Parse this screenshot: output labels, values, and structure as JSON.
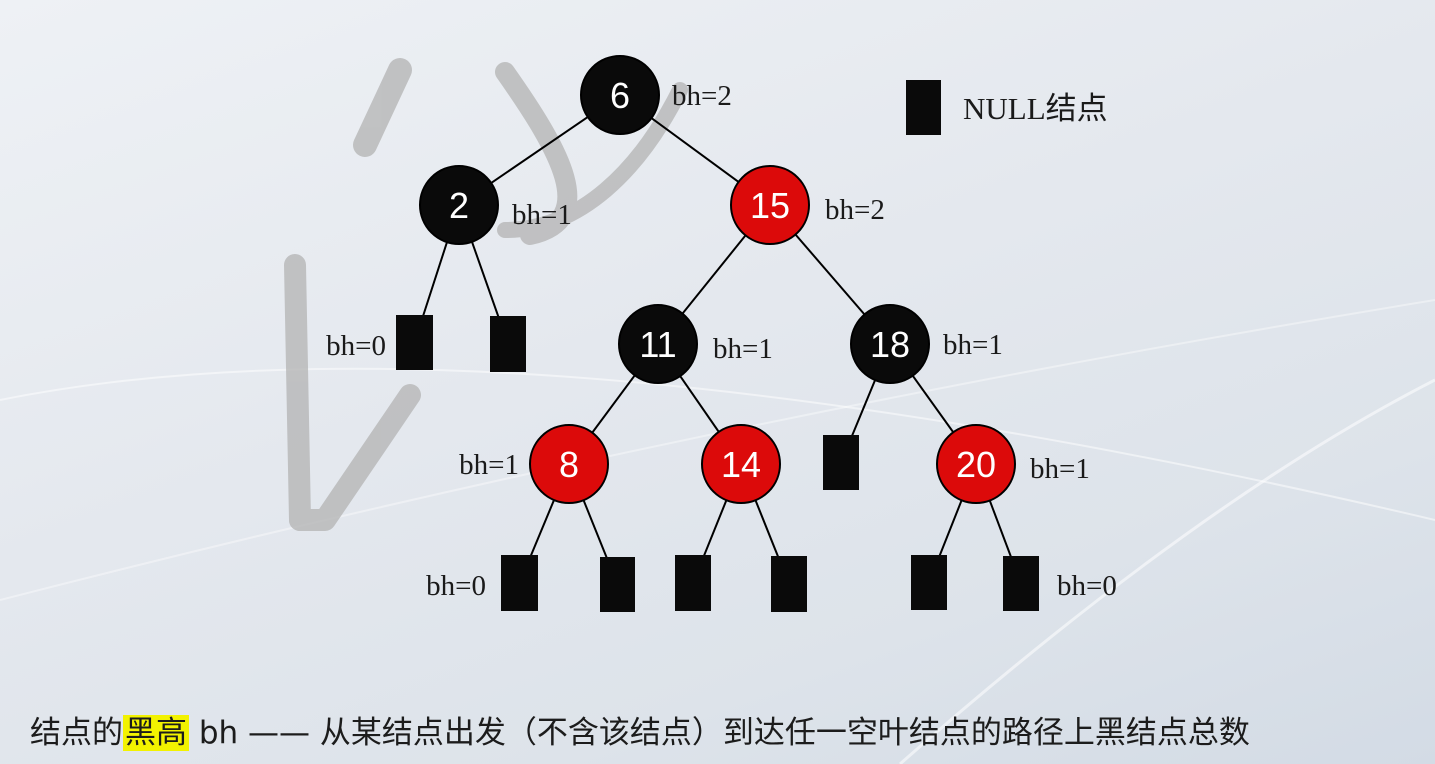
{
  "legend": {
    "null_label": "NULL结点"
  },
  "colors": {
    "black_node": "#0a0a0a",
    "red_node": "#dc0a0a",
    "node_text": "#ffffff",
    "leaf": "#0a0a0a",
    "highlight": "#f2f200",
    "edge": "#000000"
  },
  "tree": {
    "nodes": [
      {
        "id": "n6",
        "label": "6",
        "color": "black",
        "bh": "bh=2"
      },
      {
        "id": "n2",
        "label": "2",
        "color": "black",
        "bh": "bh=1"
      },
      {
        "id": "n15",
        "label": "15",
        "color": "red",
        "bh": "bh=2"
      },
      {
        "id": "n11",
        "label": "11",
        "color": "black",
        "bh": "bh=1"
      },
      {
        "id": "n18",
        "label": "18",
        "color": "black",
        "bh": "bh=1"
      },
      {
        "id": "n8",
        "label": "8",
        "color": "red",
        "bh": "bh=1"
      },
      {
        "id": "n14",
        "label": "14",
        "color": "red",
        "bh": ""
      },
      {
        "id": "n20",
        "label": "20",
        "color": "red",
        "bh": "bh=1"
      }
    ],
    "null_leaves": [
      {
        "id": "l2a",
        "bh": "bh=0"
      },
      {
        "id": "l2b",
        "bh": ""
      },
      {
        "id": "l18a",
        "bh": ""
      },
      {
        "id": "l8a",
        "bh": "bh=0"
      },
      {
        "id": "l8b",
        "bh": ""
      },
      {
        "id": "l14a",
        "bh": ""
      },
      {
        "id": "l14b",
        "bh": ""
      },
      {
        "id": "l20a",
        "bh": ""
      },
      {
        "id": "l20b",
        "bh": "bh=0"
      }
    ],
    "edges": [
      [
        "n6",
        "n2"
      ],
      [
        "n6",
        "n15"
      ],
      [
        "n2",
        "l2a"
      ],
      [
        "n2",
        "l2b"
      ],
      [
        "n15",
        "n11"
      ],
      [
        "n15",
        "n18"
      ],
      [
        "n11",
        "n8"
      ],
      [
        "n11",
        "n14"
      ],
      [
        "n18",
        "l18a"
      ],
      [
        "n18",
        "n20"
      ],
      [
        "n8",
        "l8a"
      ],
      [
        "n8",
        "l8b"
      ],
      [
        "n14",
        "l14a"
      ],
      [
        "n14",
        "l14b"
      ],
      [
        "n20",
        "l20a"
      ],
      [
        "n20",
        "l20b"
      ]
    ]
  },
  "caption": {
    "prefix": "结点的",
    "highlight": "黑高",
    "suffix": " bh —— 从某结点出发（不含该结点）到达任一空叶结点的路径上黑结点总数"
  }
}
